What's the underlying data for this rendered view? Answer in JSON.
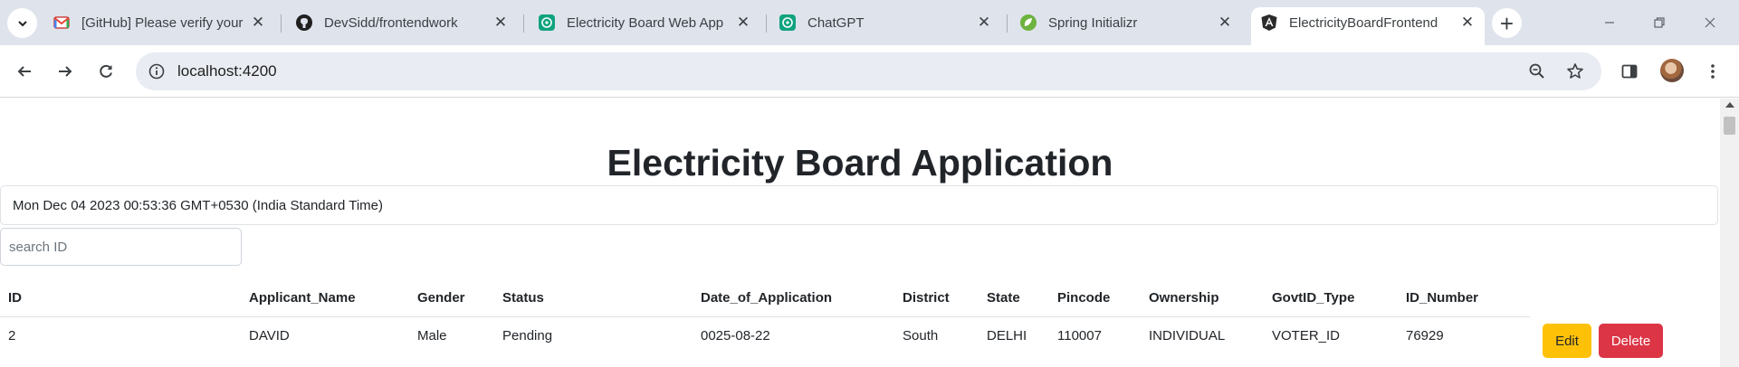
{
  "browser": {
    "tabs": [
      {
        "title": "[GitHub] Please verify your",
        "icon": "gmail-icon"
      },
      {
        "title": "DevSidd/frontendwork",
        "icon": "github-icon"
      },
      {
        "title": "Electricity Board Web App",
        "icon": "chatgpt-icon"
      },
      {
        "title": "ChatGPT",
        "icon": "chatgpt-icon"
      },
      {
        "title": "Spring Initializr",
        "icon": "spring-icon"
      },
      {
        "title": "ElectricityBoardFrontend",
        "icon": "angular-icon",
        "active": true
      }
    ],
    "close_glyph": "✕",
    "new_tab_glyph": "+",
    "url": "localhost:4200"
  },
  "page": {
    "title": "Electricity Board Application",
    "datetime": "Mon Dec 04 2023 00:53:36 GMT+0530 (India Standard Time)",
    "search": {
      "placeholder": "search ID",
      "value": ""
    },
    "table": {
      "columns": [
        "ID",
        "Applicant_Name",
        "Gender",
        "Status",
        "Date_of_Application",
        "District",
        "State",
        "Pincode",
        "Ownership",
        "GovtID_Type",
        "ID_Number"
      ],
      "rows": [
        [
          "2",
          "DAVID",
          "Male",
          "Pending",
          "0025-08-22",
          "South",
          "DELHI",
          "110007",
          "INDIVIDUAL",
          "VOTER_ID",
          "76929"
        ]
      ]
    },
    "actions": {
      "edit_label": "Edit",
      "delete_label": "Delete"
    }
  },
  "colors": {
    "tabstrip": "#dfe3ec",
    "edit_button": "#ffc107",
    "delete_button": "#dc3545"
  }
}
